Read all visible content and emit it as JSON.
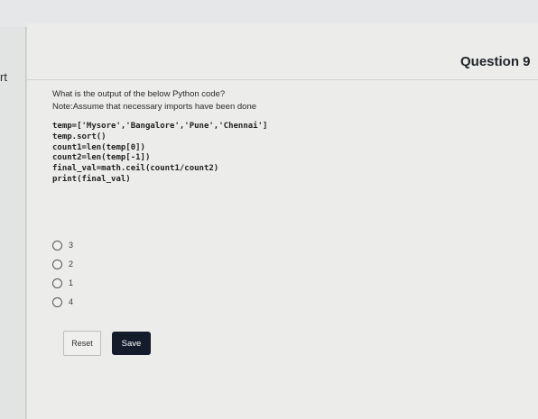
{
  "left_tab": {
    "text": "rt"
  },
  "question": {
    "number_label": "Question 9",
    "prompt": "What is the output of the below Python code?",
    "note": "Note:Assume that necessary imports have been done",
    "code_lines": [
      "temp=['Mysore','Bangalore','Pune','Chennai']",
      "temp.sort()",
      "count1=len(temp[0])",
      "count2=len(temp[-1])",
      "final_val=math.ceil(count1/count2)",
      "print(final_val)"
    ]
  },
  "options": [
    {
      "label": "3"
    },
    {
      "label": "2"
    },
    {
      "label": "1"
    },
    {
      "label": "4"
    }
  ],
  "buttons": {
    "reset": "Reset",
    "save": "Save"
  }
}
